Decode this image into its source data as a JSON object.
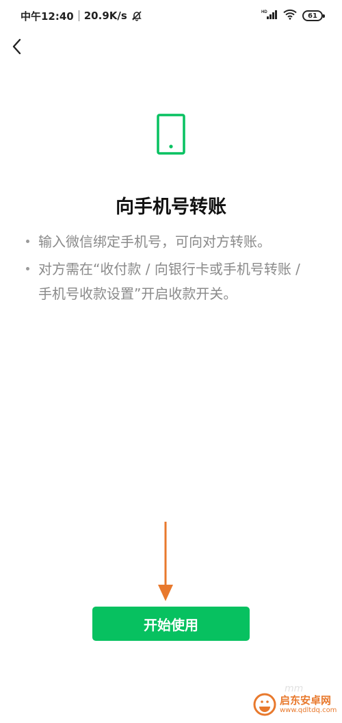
{
  "status_bar": {
    "time": "中午12:40",
    "speed": "20.9K/s",
    "network_label": "HD",
    "battery_level": "61"
  },
  "nav": {
    "back_icon": "chevron-left-icon"
  },
  "hero": {
    "icon": "phone-icon",
    "title": "向手机号转账",
    "bullets": [
      "输入微信绑定手机号，可向对方转账。",
      "对方需在“收付款 / 向银行卡或手机号转账 / 手机号收款设置”开启收款开关。"
    ]
  },
  "action": {
    "start_label": "开始使用"
  },
  "colors": {
    "brand_green": "#07c160",
    "arrow_orange": "#e8792d",
    "text_gray": "#8a8a8a"
  },
  "watermark": {
    "name": "启东安卓网",
    "url": "www.qdltdq.com",
    "faint_text": "mm"
  }
}
